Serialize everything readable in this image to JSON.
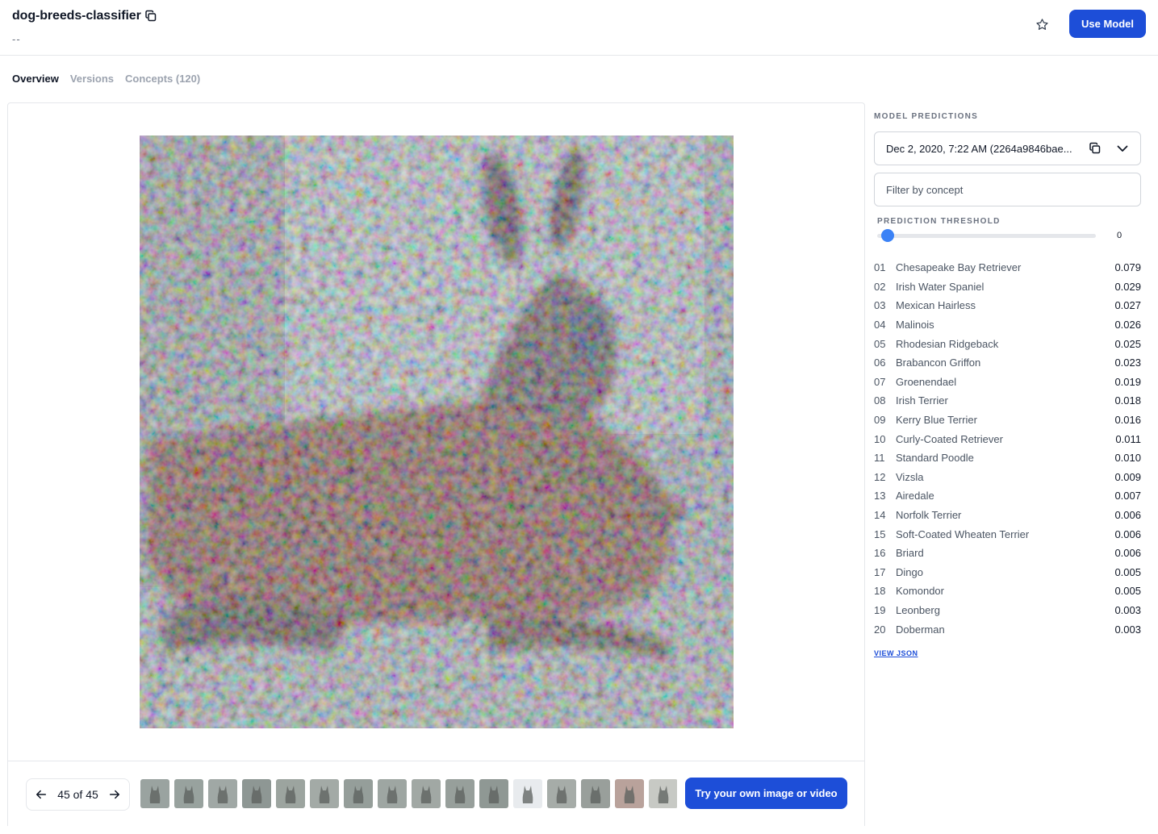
{
  "header": {
    "title": "dog-breeds-classifier",
    "subtitle": "--",
    "use_model_label": "Use Model"
  },
  "tabs": [
    {
      "label": "Overview",
      "active": true
    },
    {
      "label": "Versions",
      "active": false
    },
    {
      "label": "Concepts (120)",
      "active": false
    }
  ],
  "viewer": {
    "pager_text": "45 of 45",
    "try_label": "Try your own image or video",
    "thumbnail_count": 16
  },
  "panel": {
    "predictions_label": "MODEL PREDICTIONS",
    "version_selected": "Dec 2, 2020, 7:22 AM (2264a9846bae...",
    "filter_placeholder": "Filter by concept",
    "threshold_label": "PREDICTION THRESHOLD",
    "threshold_value": "0",
    "view_json_label": "VIEW JSON",
    "predictions": [
      {
        "num": "01",
        "name": "Chesapeake Bay Retriever",
        "value": "0.079"
      },
      {
        "num": "02",
        "name": "Irish Water Spaniel",
        "value": "0.029"
      },
      {
        "num": "03",
        "name": "Mexican Hairless",
        "value": "0.027"
      },
      {
        "num": "04",
        "name": "Malinois",
        "value": "0.026"
      },
      {
        "num": "05",
        "name": "Rhodesian Ridgeback",
        "value": "0.025"
      },
      {
        "num": "06",
        "name": "Brabancon Griffon",
        "value": "0.023"
      },
      {
        "num": "07",
        "name": "Groenendael",
        "value": "0.019"
      },
      {
        "num": "08",
        "name": "Irish Terrier",
        "value": "0.018"
      },
      {
        "num": "09",
        "name": "Kerry Blue Terrier",
        "value": "0.016"
      },
      {
        "num": "10",
        "name": "Curly-Coated Retriever",
        "value": "0.011"
      },
      {
        "num": "11",
        "name": "Standard Poodle",
        "value": "0.010"
      },
      {
        "num": "12",
        "name": "Vizsla",
        "value": "0.009"
      },
      {
        "num": "13",
        "name": "Airedale",
        "value": "0.007"
      },
      {
        "num": "14",
        "name": "Norfolk Terrier",
        "value": "0.006"
      },
      {
        "num": "15",
        "name": "Soft-Coated Wheaten Terrier",
        "value": "0.006"
      },
      {
        "num": "16",
        "name": "Briard",
        "value": "0.006"
      },
      {
        "num": "17",
        "name": "Dingo",
        "value": "0.005"
      },
      {
        "num": "18",
        "name": "Komondor",
        "value": "0.005"
      },
      {
        "num": "19",
        "name": "Leonberg",
        "value": "0.003"
      },
      {
        "num": "20",
        "name": "Doberman",
        "value": "0.003"
      }
    ]
  },
  "colors": {
    "accent": "#1d4ed8",
    "slider_knob": "#3b82f6",
    "border": "#e5e7eb"
  }
}
